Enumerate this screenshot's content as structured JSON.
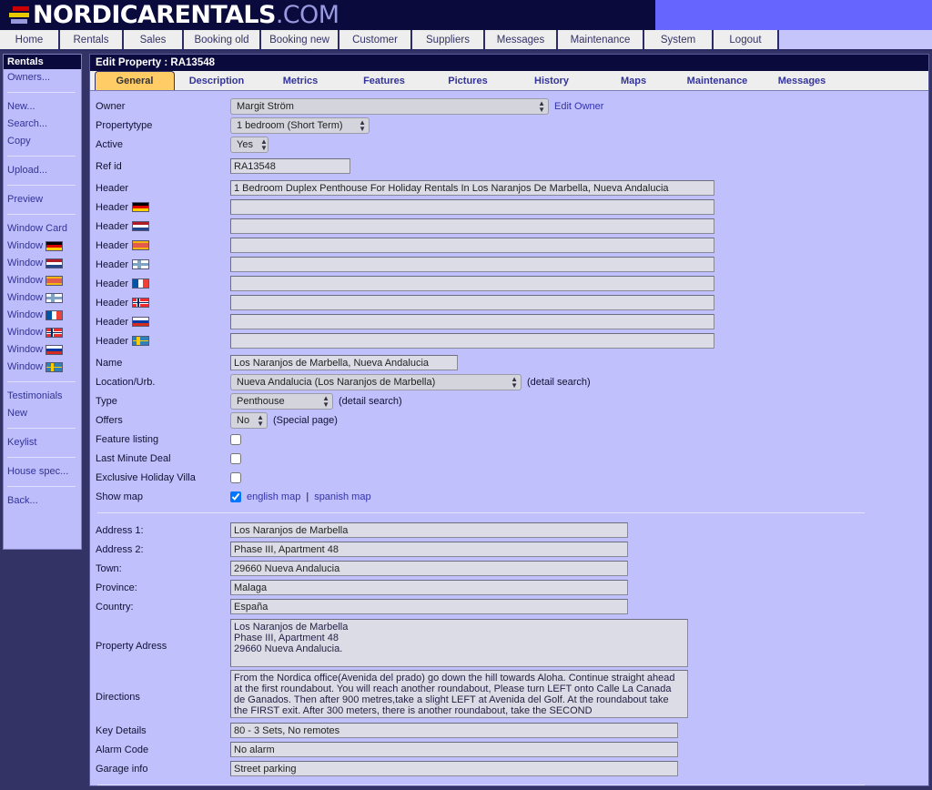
{
  "brand": {
    "name_main": "NORDICARENTALS",
    "name_tld": ".COM",
    "logo_colors": [
      "#cc0000",
      "#e8c800",
      "#9999dd"
    ]
  },
  "nav": {
    "items": [
      {
        "label": "Home"
      },
      {
        "label": "Rentals"
      },
      {
        "label": "Sales"
      },
      {
        "label": "Booking old"
      },
      {
        "label": "Booking new"
      },
      {
        "label": "Customer"
      },
      {
        "label": "Suppliers"
      },
      {
        "label": "Messages"
      },
      {
        "label": "Maintenance"
      },
      {
        "label": "System"
      },
      {
        "label": "Logout"
      }
    ]
  },
  "sidebar": {
    "title": "Rentals",
    "groups": [
      {
        "items": [
          {
            "label": "Owners...",
            "icon": null
          }
        ]
      },
      {
        "items": [
          {
            "label": "New...",
            "icon": null
          },
          {
            "label": "Search...",
            "icon": null
          },
          {
            "label": "Copy",
            "icon": null
          }
        ]
      },
      {
        "items": [
          {
            "label": "Upload...",
            "icon": null
          }
        ]
      },
      {
        "items": [
          {
            "label": "Preview",
            "icon": null
          }
        ]
      },
      {
        "items": [
          {
            "label": "Window Card",
            "icon": null
          },
          {
            "label": "Window",
            "icon": "flag-de"
          },
          {
            "label": "Window",
            "icon": "flag-nl"
          },
          {
            "label": "Window",
            "icon": "flag-es"
          },
          {
            "label": "Window",
            "icon": "flag-fi"
          },
          {
            "label": "Window",
            "icon": "flag-fr"
          },
          {
            "label": "Window",
            "icon": "flag-no"
          },
          {
            "label": "Window",
            "icon": "flag-ru"
          },
          {
            "label": "Window",
            "icon": "flag-se"
          }
        ]
      },
      {
        "items": [
          {
            "label": "Testimonials",
            "icon": null
          },
          {
            "label": "New",
            "icon": null
          }
        ]
      },
      {
        "items": [
          {
            "label": "Keylist",
            "icon": null
          }
        ]
      },
      {
        "items": [
          {
            "label": "House spec...",
            "icon": null
          }
        ]
      },
      {
        "items": [
          {
            "label": "Back...",
            "icon": null
          }
        ]
      }
    ]
  },
  "main": {
    "title": "Edit Property : RA13548",
    "tabs": [
      {
        "label": "General",
        "active": true
      },
      {
        "label": "Description",
        "active": false
      },
      {
        "label": "Metrics",
        "active": false
      },
      {
        "label": "Features",
        "active": false
      },
      {
        "label": "Pictures",
        "active": false
      },
      {
        "label": "History",
        "active": false
      },
      {
        "label": "Maps",
        "active": false
      },
      {
        "label": "Maintenance",
        "active": false
      },
      {
        "label": "Messages",
        "active": false
      }
    ]
  },
  "form": {
    "owner": {
      "label": "Owner",
      "value": "Margit Ström",
      "edit_link": "Edit Owner"
    },
    "propertytype": {
      "label": "Propertytype",
      "value": "1 bedroom (Short Term)"
    },
    "active": {
      "label": "Active",
      "value": "Yes"
    },
    "ref_id": {
      "label": "Ref id",
      "value": "RA13548"
    },
    "headers": [
      {
        "label": "Header",
        "flag": null,
        "value": "1 Bedroom Duplex Penthouse For Holiday Rentals In Los Naranjos De Marbella, Nueva Andalucia"
      },
      {
        "label": "Header",
        "flag": "flag-de",
        "value": ""
      },
      {
        "label": "Header",
        "flag": "flag-nl",
        "value": ""
      },
      {
        "label": "Header",
        "flag": "flag-es",
        "value": ""
      },
      {
        "label": "Header",
        "flag": "flag-fi",
        "value": ""
      },
      {
        "label": "Header",
        "flag": "flag-fr",
        "value": ""
      },
      {
        "label": "Header",
        "flag": "flag-no",
        "value": ""
      },
      {
        "label": "Header",
        "flag": "flag-ru",
        "value": ""
      },
      {
        "label": "Header",
        "flag": "flag-se",
        "value": ""
      }
    ],
    "name": {
      "label": "Name",
      "value": "Los Naranjos de Marbella, Nueva Andalucia"
    },
    "location": {
      "label": "Location/Urb.",
      "value": "Nueva Andalucia (Los Naranjos de Marbella)",
      "note": "(detail search)"
    },
    "type": {
      "label": "Type",
      "value": "Penthouse",
      "note": "(detail search)"
    },
    "offers": {
      "label": "Offers",
      "value": "No",
      "note": "(Special page)"
    },
    "feature_listing": {
      "label": "Feature listing",
      "checked": false
    },
    "last_minute_deal": {
      "label": "Last Minute Deal",
      "checked": false
    },
    "exclusive_holiday_villa": {
      "label": "Exclusive Holiday Villa",
      "checked": false
    },
    "show_map": {
      "label": "Show map",
      "checked": true,
      "link_english": "english map",
      "separator": "|",
      "link_spanish": "spanish map"
    },
    "address1": {
      "label": "Address 1:",
      "value": "Los Naranjos de Marbella"
    },
    "address2": {
      "label": "Address 2:",
      "value": "Phase III, Apartment 48"
    },
    "town": {
      "label": "Town:",
      "value": "29660 Nueva Andalucia"
    },
    "province": {
      "label": "Province:",
      "value": "Malaga"
    },
    "country": {
      "label": "Country:",
      "value": "España"
    },
    "property_address": {
      "label": "Property Adress",
      "value": "Los Naranjos de Marbella\nPhase III, Apartment 48\n29660 Nueva Andalucia."
    },
    "directions": {
      "label": "Directions",
      "value": "From the Nordica office(Avenida del prado) go down the hill towards Aloha. Continue straight ahead at the first roundabout. You will reach another roundabout, Please turn LEFT onto Calle La Canada de Ganados. Then after 900 metres,take a slight LEFT at Avenida del Golf. At the roundabout take the FIRST exit. After 300 meters, there is another roundabout, take the SECOND"
    },
    "key_details": {
      "label": "Key Details",
      "value": "80 - 3 Sets, No remotes"
    },
    "alarm_code": {
      "label": "Alarm Code",
      "value": "No alarm"
    },
    "garage_info": {
      "label": "Garage info",
      "value": "Street parking"
    }
  }
}
